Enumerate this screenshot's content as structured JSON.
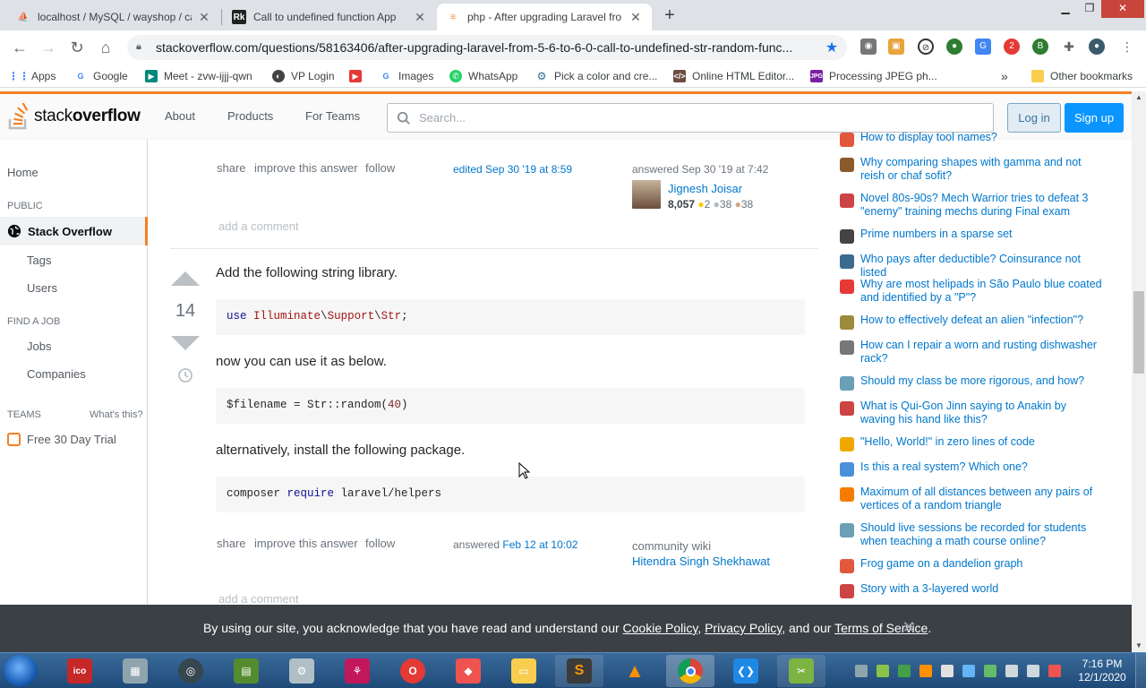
{
  "browser": {
    "tabs": [
      {
        "title": "localhost / MySQL / wayshop / ca",
        "active": false
      },
      {
        "title": "Call to undefined function App",
        "active": false
      },
      {
        "title": "php - After upgrading Laravel fro",
        "active": true
      }
    ],
    "url": "stackoverflow.com/questions/58163406/after-upgrading-laravel-from-5-6-to-6-0-call-to-undefined-str-random-func...",
    "bookmarks": [
      "Apps",
      "Google",
      "Meet - zvw-ijjj-qwn",
      "VP Login",
      "",
      "Images",
      "WhatsApp",
      "Pick a color and cre...",
      "Online HTML Editor...",
      "Processing JPEG ph...",
      "Other bookmarks"
    ],
    "ext_badge": "2"
  },
  "so": {
    "logo_light": "stack",
    "logo_bold": "overflow",
    "nav": [
      "About",
      "Products",
      "For Teams"
    ],
    "search_placeholder": "Search...",
    "login": "Log in",
    "signup": "Sign up"
  },
  "leftnav": {
    "home": "Home",
    "public": "PUBLIC",
    "stackoverflow": "Stack Overflow",
    "tags": "Tags",
    "users": "Users",
    "find_job": "FIND A JOB",
    "jobs": "Jobs",
    "companies": "Companies",
    "teams": "TEAMS",
    "whats_this": "What's this?",
    "trial": "Free 30 Day Trial"
  },
  "answer1": {
    "share": "share",
    "improve": "improve this answer",
    "follow": "follow",
    "edited": "edited Sep 30 '19 at 8:59",
    "answered_label": "answered Sep 30 '19 at 7:42",
    "user": "Jignesh Joisar",
    "rep": "8,057",
    "gold": "2",
    "silver": "38",
    "bronze": "38",
    "add_comment": "add a comment"
  },
  "answer2": {
    "votes": "14",
    "p1": "Add the following string library.",
    "code1": {
      "kw": "use",
      "a": "Illuminate",
      "b": "Support",
      "c": "Str",
      "sep": "\\",
      "end": ";"
    },
    "p2": "now you can use it as below.",
    "code2": {
      "pre": "$filename = Str::random(",
      "num": "40",
      "post": ")"
    },
    "p3": "alternatively, install the following package.",
    "code3": {
      "cmd": "composer ",
      "kw": "require",
      "pkg": " laravel/helpers"
    },
    "share": "share",
    "improve": "improve this answer",
    "follow": "follow",
    "answered": "answered",
    "answered_date": "Feb 12 at 10:02",
    "wiki": "community wiki",
    "user": "Hitendra Singh Shekhawat",
    "add_comment": "add a comment"
  },
  "hot_questions": [
    {
      "text": "How to display tool names?",
      "color": "#e2583e"
    },
    {
      "text": "Why comparing shapes with gamma and not reish or chaf sofit?",
      "color": "#8a5a2b"
    },
    {
      "text": "Novel 80s-90s? Mech Warrior tries to defeat 3 \"enemy\" training mechs during Final exam",
      "color": "#c44"
    },
    {
      "text": "Prime numbers in a sparse set",
      "color": "#444"
    },
    {
      "text": "Who pays after deductible? Coinsurance not listed",
      "color": "#3b6b8f"
    },
    {
      "text": "Why are most helipads in São Paulo blue coated and identified by a \"P\"?",
      "color": "#e53935"
    },
    {
      "text": "How to effectively defeat an alien \"infection\"?",
      "color": "#9c8b3a"
    },
    {
      "text": "How can I repair a worn and rusting dishwasher rack?",
      "color": "#777"
    },
    {
      "text": "Should my class be more rigorous, and how?",
      "color": "#6a9fb5"
    },
    {
      "text": "What is Qui-Gon Jinn saying to Anakin by waving his hand like this?",
      "color": "#c44"
    },
    {
      "text": "\"Hello, World!\" in zero lines of code",
      "color": "#f0a800"
    },
    {
      "text": "Is this a real system? Which one?",
      "color": "#4a90d9"
    },
    {
      "text": "Maximum of all distances between any pairs of vertices of a random triangle",
      "color": "#f57c00"
    },
    {
      "text": "Should live sessions be recorded for students when teaching a math course online?",
      "color": "#6a9fb5"
    },
    {
      "text": "Frog game on a dandelion graph",
      "color": "#e2583e"
    },
    {
      "text": "Story with a 3-layered world",
      "color": "#c44"
    }
  ],
  "cookie": {
    "pre": "By using our site, you acknowledge that you have read and understand our ",
    "cookie_policy": "Cookie Policy",
    "sep": ", ",
    "privacy": "Privacy Policy",
    "and": ", and our ",
    "terms": "Terms of Service",
    "end": "."
  },
  "taskbar": {
    "time": "7:16 PM",
    "date": "12/1/2020"
  }
}
